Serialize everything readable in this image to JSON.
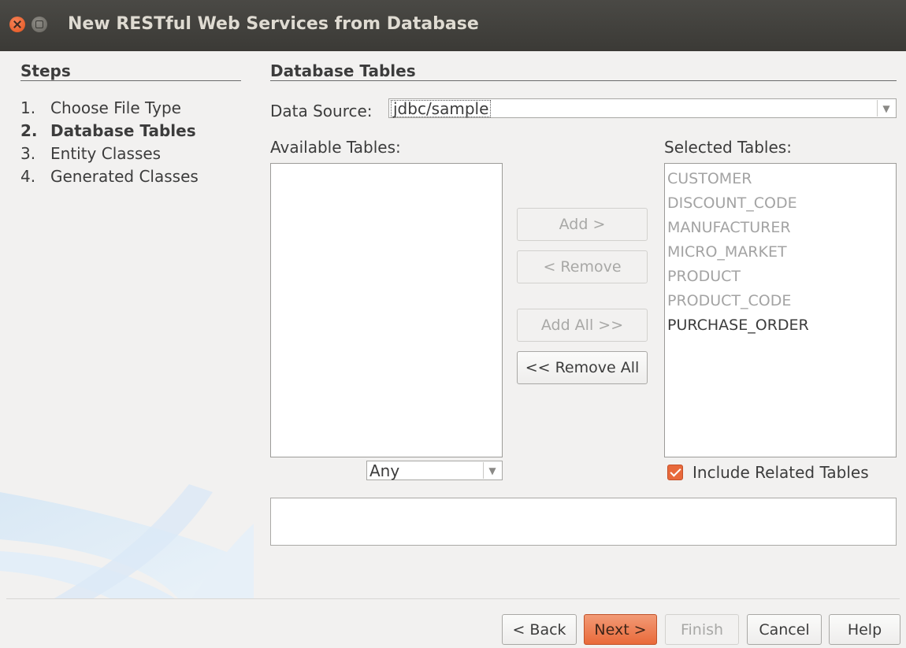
{
  "window": {
    "title": "New RESTful Web Services from Database"
  },
  "steps": {
    "heading": "Steps",
    "items": [
      {
        "num": "1.",
        "label": "Choose File Type",
        "active": false
      },
      {
        "num": "2.",
        "label": "Database Tables",
        "active": true
      },
      {
        "num": "3.",
        "label": "Entity Classes",
        "active": false
      },
      {
        "num": "4.",
        "label": "Generated Classes",
        "active": false
      }
    ]
  },
  "content": {
    "heading": "Database Tables",
    "data_source": {
      "label": "Data Source:",
      "value": "jdbc/sample"
    },
    "available": {
      "label": "Available Tables:",
      "filter": "Any"
    },
    "selected": {
      "label": "Selected Tables:",
      "items": [
        {
          "name": "CUSTOMER",
          "enabled": false
        },
        {
          "name": "DISCOUNT_CODE",
          "enabled": false
        },
        {
          "name": "MANUFACTURER",
          "enabled": false
        },
        {
          "name": "MICRO_MARKET",
          "enabled": false
        },
        {
          "name": "PRODUCT",
          "enabled": false
        },
        {
          "name": "PRODUCT_CODE",
          "enabled": false
        },
        {
          "name": "PURCHASE_ORDER",
          "enabled": true
        }
      ]
    },
    "buttons": {
      "add": "Add >",
      "remove": "< Remove",
      "add_all": "Add All >>",
      "remove_all": "<< Remove All"
    },
    "include_related": {
      "label": "Include Related Tables",
      "checked": true
    }
  },
  "footer": {
    "back": "< Back",
    "next": "Next >",
    "finish": "Finish",
    "cancel": "Cancel",
    "help": "Help"
  },
  "colors": {
    "accent": "#e96a3a",
    "titlebar": "#3d3c38"
  }
}
